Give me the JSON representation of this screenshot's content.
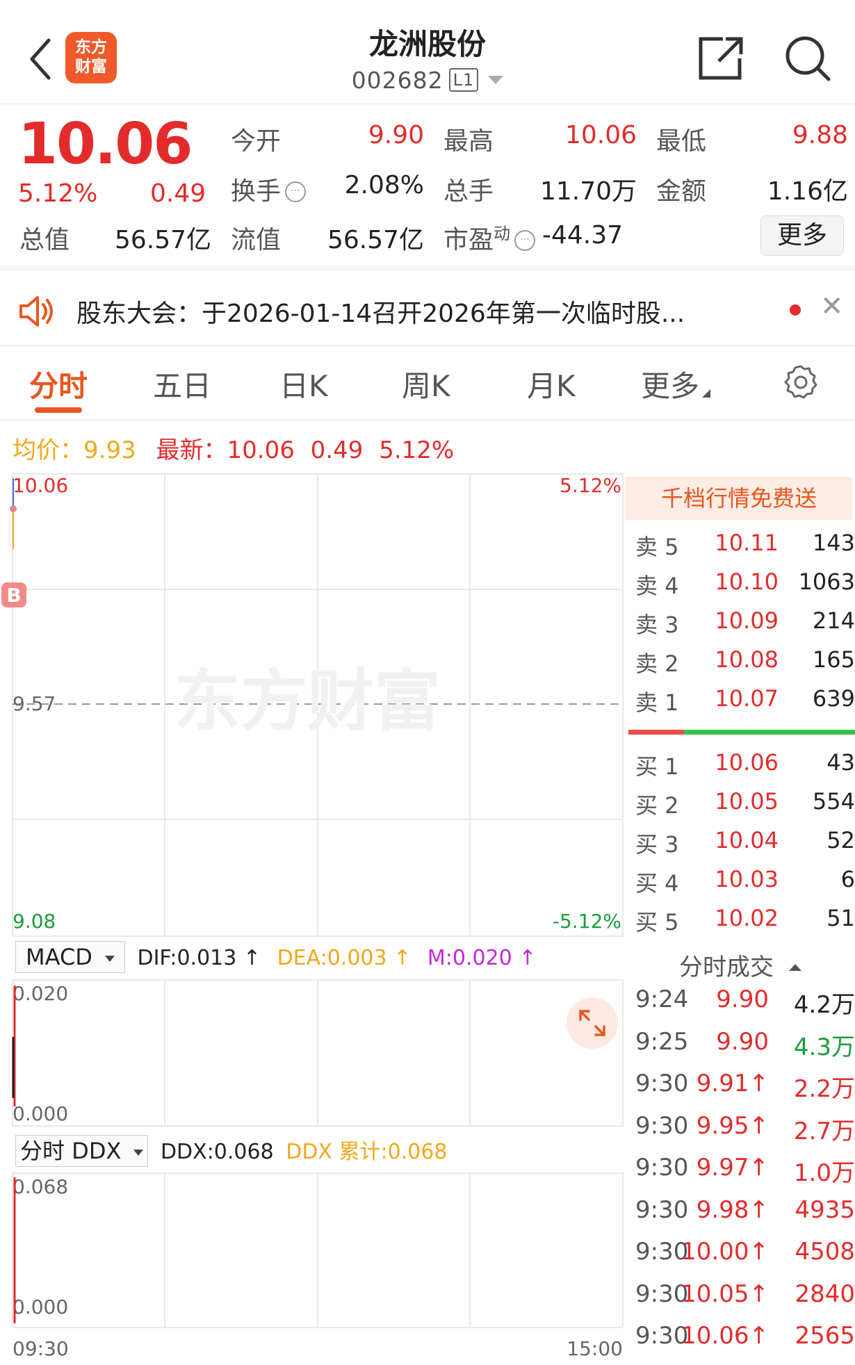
{
  "header": {
    "logo_line1": "东方",
    "logo_line2": "财富",
    "stock_name": "龙洲股份",
    "stock_code": "002682",
    "level_badge": "L1",
    "icons": [
      "back-icon",
      "share-icon",
      "search-icon"
    ]
  },
  "quote": {
    "price": "10.06",
    "change_pct": "5.12%",
    "change_amt": "0.49",
    "open_label": "今开",
    "open_value": "9.90",
    "high_label": "最高",
    "high_value": "10.06",
    "low_label": "最低",
    "low_value": "9.88",
    "turnover_label": "换手",
    "turnover_value": "2.08%",
    "volume_label": "总手",
    "volume_value": "11.70万",
    "amount_label": "金额",
    "amount_value": "1.16亿",
    "mktcap_label": "总值",
    "mktcap_value": "56.57亿",
    "float_label": "流值",
    "float_value": "56.57亿",
    "pe_label": "市盈",
    "pe_sup": "动",
    "pe_value": "-44.37",
    "more_label": "更多"
  },
  "notice": {
    "text": "股东大会：于2026-01-14召开2026年第一次临时股..."
  },
  "tabs": [
    {
      "label": "分时"
    },
    {
      "label": "五日"
    },
    {
      "label": "日K"
    },
    {
      "label": "周K"
    },
    {
      "label": "月K"
    },
    {
      "label": "更多"
    }
  ],
  "price_line": {
    "avg_label": "均价：",
    "avg_value": "9.93",
    "latest_label": "最新：",
    "latest_value": "10.06",
    "latest_chg": "0.49",
    "latest_pct": "5.12%"
  },
  "chart_data": {
    "type": "line",
    "y_top": "10.06",
    "y_mid": "9.57",
    "y_bottom": "9.08",
    "pct_top": "5.12%",
    "pct_bottom": "-5.12%",
    "ylim": [
      9.08,
      10.06
    ],
    "x_start": "09:30",
    "x_end": "15:00",
    "buy_marker": "B",
    "watermark": "东方财富"
  },
  "macd": {
    "selector": "MACD",
    "dif": "DIF:0.013 ↑",
    "dea": "DEA:0.003 ↑",
    "m": "M:0.020 ↑",
    "y_top": "0.020",
    "y_bottom": "0.000"
  },
  "ddx": {
    "selector": "分时 DDX",
    "ddx": "DDX:0.068",
    "ddx_cum": "DDX 累计:0.068",
    "y_top": "0.068",
    "y_bottom": "0.000"
  },
  "orderbook": {
    "promo": "千档行情免费送",
    "asks": [
      {
        "label": "卖 5",
        "price": "10.11",
        "vol": "143"
      },
      {
        "label": "卖 4",
        "price": "10.10",
        "vol": "1063"
      },
      {
        "label": "卖 3",
        "price": "10.09",
        "vol": "214"
      },
      {
        "label": "卖 2",
        "price": "10.08",
        "vol": "165"
      },
      {
        "label": "卖 1",
        "price": "10.07",
        "vol": "639"
      }
    ],
    "bids": [
      {
        "label": "买 1",
        "price": "10.06",
        "vol": "43"
      },
      {
        "label": "买 2",
        "price": "10.05",
        "vol": "554"
      },
      {
        "label": "买 3",
        "price": "10.04",
        "vol": "52"
      },
      {
        "label": "买 4",
        "price": "10.03",
        "vol": "6"
      },
      {
        "label": "买 5",
        "price": "10.02",
        "vol": "51"
      }
    ]
  },
  "trades": {
    "title": "分时成交",
    "rows": [
      {
        "time": "9:24",
        "price": "9.90",
        "vol": "4.2万",
        "vol_color": "#222222"
      },
      {
        "time": "9:25",
        "price": "9.90",
        "vol": "4.3万",
        "vol_color": "#1a9c3c"
      },
      {
        "time": "9:30",
        "price": "9.91↑",
        "vol": "2.2万",
        "vol_color": "#e32b2b"
      },
      {
        "time": "9:30",
        "price": "9.95↑",
        "vol": "2.7万",
        "vol_color": "#e32b2b"
      },
      {
        "time": "9:30",
        "price": "9.97↑",
        "vol": "1.0万",
        "vol_color": "#e32b2b"
      },
      {
        "time": "9:30",
        "price": "9.98↑",
        "vol": "4935",
        "vol_color": "#e32b2b"
      },
      {
        "time": "9:30",
        "price": "10.00↑",
        "vol": "4508",
        "vol_color": "#e32b2b"
      },
      {
        "time": "9:30",
        "price": "10.05↑",
        "vol": "2840",
        "vol_color": "#e32b2b"
      },
      {
        "time": "9:30",
        "price": "10.06↑",
        "vol": "2565",
        "vol_color": "#e32b2b"
      }
    ]
  },
  "colors": {
    "up": "#e32b2b",
    "down": "#1a9c3c",
    "brand": "#e8561e",
    "avg": "#f0a81c"
  }
}
